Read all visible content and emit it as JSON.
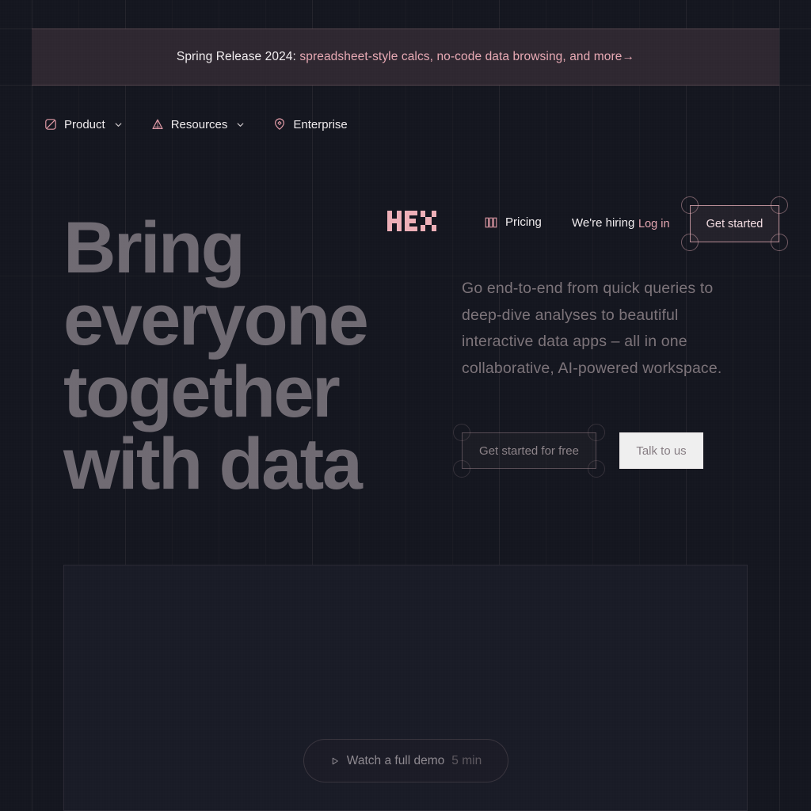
{
  "banner": {
    "lead": "Spring Release 2024:",
    "link": "spreadsheet-style calcs, no-code data browsing, and more→"
  },
  "nav": {
    "items": [
      {
        "label": "Product",
        "icon": "square-slash-icon",
        "caret": true
      },
      {
        "label": "Resources",
        "icon": "pyramid-icon",
        "caret": true
      },
      {
        "label": "Enterprise",
        "icon": "shield-pin-icon",
        "caret": false
      }
    ],
    "logo_text": "HEX",
    "pricing": {
      "label": "Pricing",
      "icon": "bars-icon"
    },
    "hiring_label": "We're hiring",
    "login_label": "Log in",
    "get_started_label": "Get started"
  },
  "hero": {
    "headline": "Bring everyone together with data",
    "subcopy": "Go end-to-end from quick queries to deep-dive analyses to beautiful interactive data apps – all in one collaborative, AI-powered workspace.",
    "cta_primary": "Get started for free",
    "cta_secondary": "Talk to us"
  },
  "demo": {
    "label": "Watch a full demo",
    "duration": "5 min",
    "icon": "play-icon"
  },
  "colors": {
    "page_bg": "#14161f",
    "banner_bg": "#2e2730",
    "accent_pink": "#e8a9b4",
    "text_primary": "#f0ecee",
    "headline": "#6f6a72",
    "panel_bg": "#191b26"
  }
}
